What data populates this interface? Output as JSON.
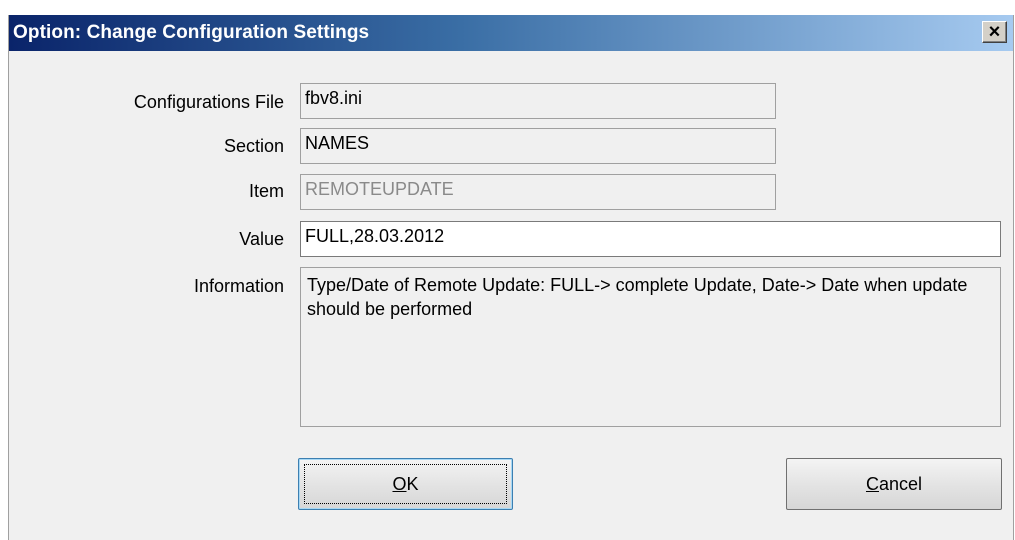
{
  "window": {
    "title": "Option: Change Configuration Settings",
    "close_label": "×"
  },
  "form": {
    "config_file": {
      "label": "Configurations File",
      "value": "fbv8.ini"
    },
    "section": {
      "label": "Section",
      "value": "NAMES"
    },
    "item": {
      "label": "Item",
      "value": "REMOTEUPDATE"
    },
    "value": {
      "label": "Value",
      "value": "FULL,28.03.2012"
    },
    "information": {
      "label": "Information",
      "text": "Type/Date of Remote Update: FULL-> complete Update, Date-> Date when update should be performed"
    }
  },
  "buttons": {
    "ok": {
      "accel": "O",
      "rest": "K"
    },
    "cancel": {
      "accel": "C",
      "rest": "ancel"
    }
  },
  "colors": {
    "title_gradient_start": "#0a246a",
    "title_gradient_end": "#a6caf0",
    "window_bg": "#f0f0f0"
  }
}
